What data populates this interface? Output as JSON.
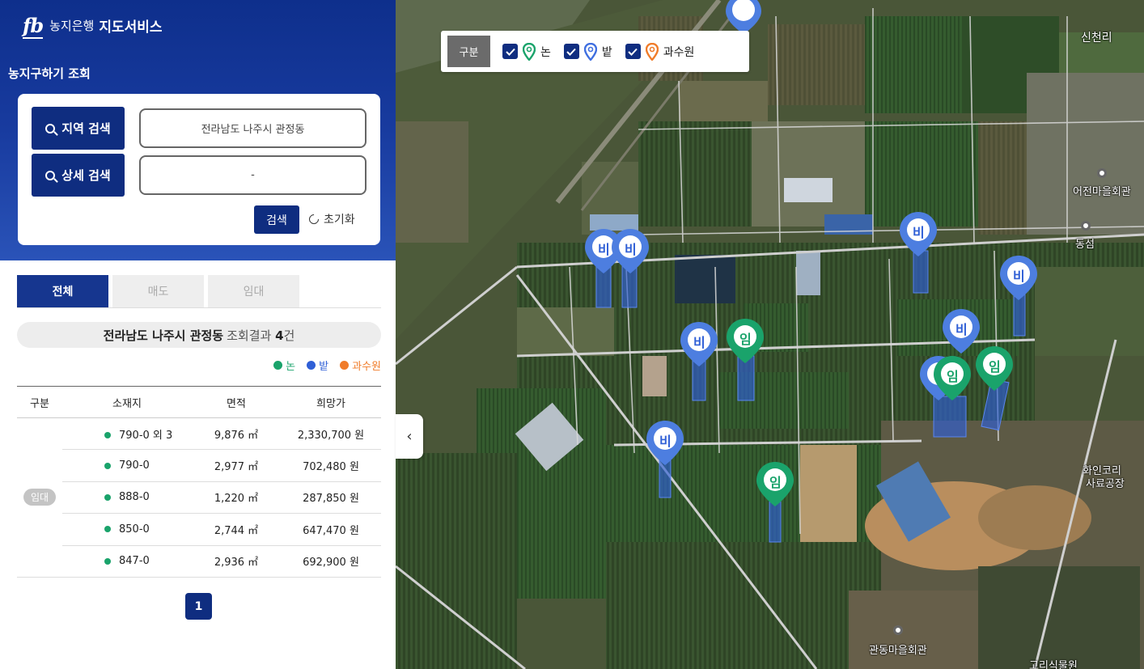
{
  "brand": {
    "logo": "fb",
    "bank": "농지은행",
    "service": "지도서비스"
  },
  "section_title": "농지구하기 조회",
  "search": {
    "region_button": "지역 검색",
    "detail_button": "상세 검색",
    "region_value": "전라남도 나주시 관정동",
    "detail_value": "-",
    "search_button": "검색",
    "reset_button": "초기화"
  },
  "tabs": [
    "전체",
    "매도",
    "임대"
  ],
  "result": {
    "region": "전라남도 나주시 관정동",
    "label": "조회결과",
    "count": "4",
    "unit": "건"
  },
  "legend": [
    {
      "label": "논",
      "color": "#1aa36b"
    },
    {
      "label": "밭",
      "color": "#2f5fd6"
    },
    {
      "label": "과수원",
      "color": "#f07c2a"
    }
  ],
  "table": {
    "headers": [
      "구분",
      "소재지",
      "면적",
      "희망가"
    ],
    "category": "임대",
    "rows": [
      {
        "location": "790-0 외 3",
        "area": "9,876 ㎡",
        "price": "2,330,700 원"
      },
      {
        "location": "790-0",
        "area": "2,977 ㎡",
        "price": "702,480 원"
      },
      {
        "location": "888-0",
        "area": "1,220 ㎡",
        "price": "287,850 원"
      },
      {
        "location": "850-0",
        "area": "2,744 ㎡",
        "price": "647,470 원"
      },
      {
        "location": "847-0",
        "area": "2,936 ㎡",
        "price": "692,900 원"
      }
    ]
  },
  "pagination": {
    "current": "1"
  },
  "map": {
    "filter": {
      "label": "구분",
      "items": [
        "논",
        "밭",
        "과수원"
      ],
      "colors": [
        "#1aa36b",
        "#3f6fe0",
        "#f07c2a"
      ]
    },
    "places": [
      "신천리",
      "어전마을회관",
      "동섬",
      "화인코리",
      "사료공장",
      "관동마을회관",
      "고리식물원"
    ],
    "marker_labels": {
      "field": "비",
      "paddy": "임"
    },
    "collapse_icon": "chevron-left-icon"
  }
}
